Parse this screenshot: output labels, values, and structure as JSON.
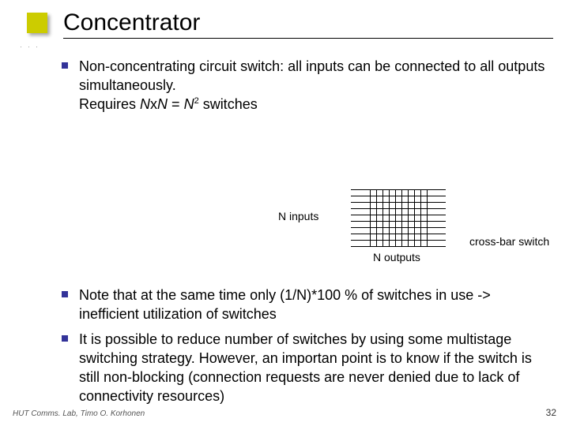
{
  "title": "Concentrator",
  "bullets": [
    "Non-concentrating circuit switch: all inputs can be connected to all outputs simultaneously.",
    "Note that at the same time only (1/N)*100 % of switches in use -> inefficient utilization of switches",
    "It is possible to reduce number of switches by using some multistage switching strategy. However, an importan point is to know if the switch is still non-blocking (connection requests are never denied due to lack of connectivity resources)"
  ],
  "formula": {
    "prefix": "Requires ",
    "expr_lhs": "N",
    "expr_dot": "x",
    "expr_rhs": "N",
    "eq": " = ",
    "n": "N",
    "sup": "2",
    "suffix": " switches"
  },
  "diagram": {
    "n_inputs_label": "N inputs",
    "n_outputs_label": "N outputs",
    "caption": "cross-bar switch"
  },
  "footer": "HUT Comms. Lab, Timo O. Korhonen",
  "page": "32"
}
